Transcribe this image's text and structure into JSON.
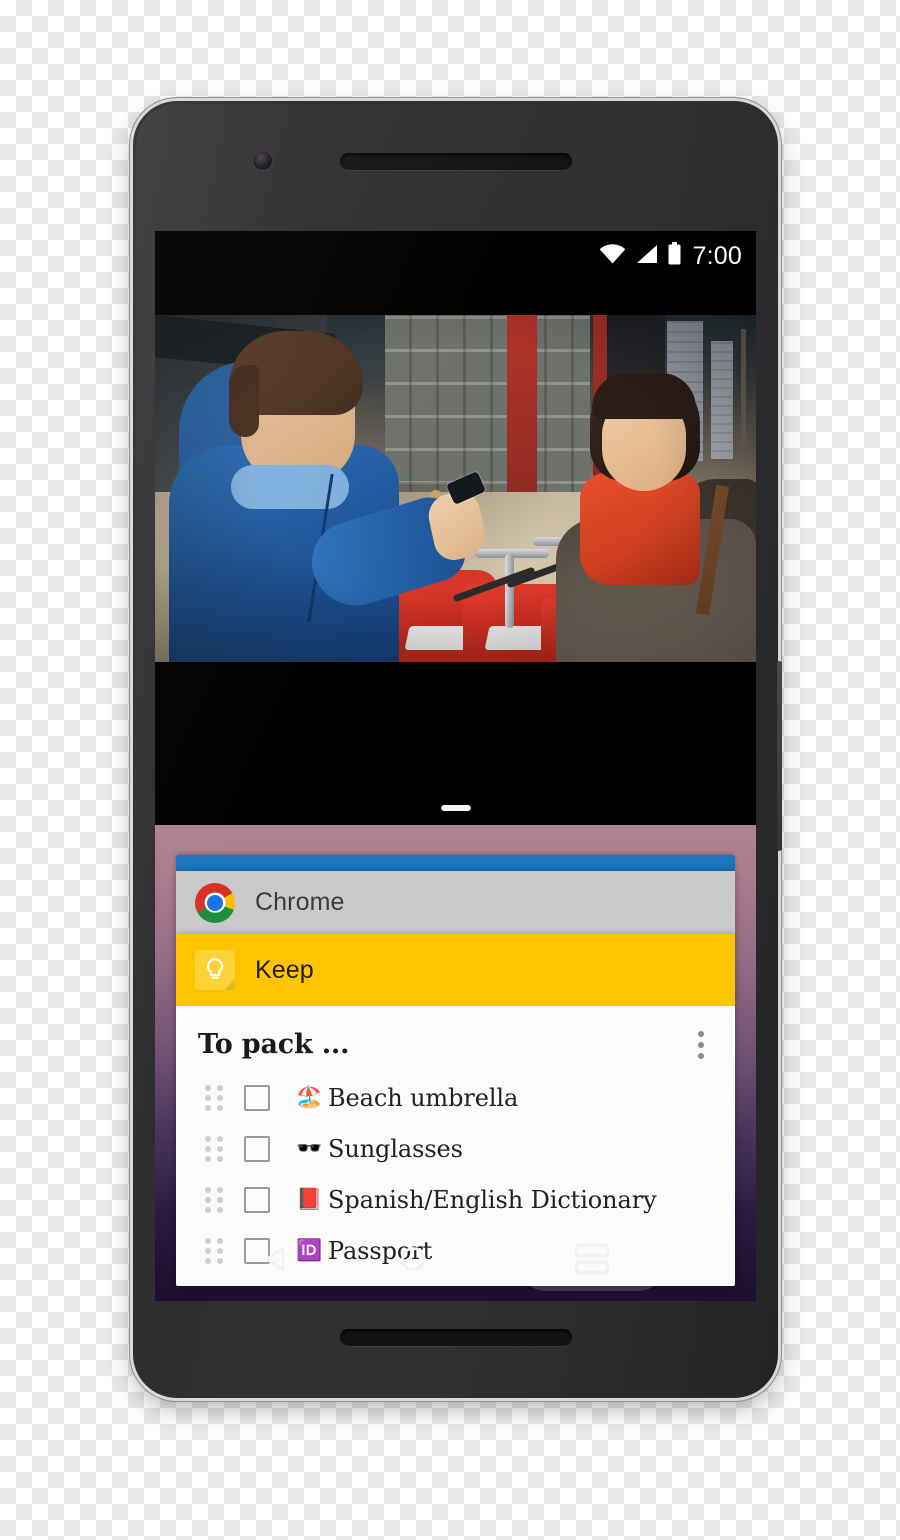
{
  "device": {
    "name": "android-phone-mockup",
    "camera_icon": "front-camera",
    "earpiece_icon": "earpiece-speaker",
    "bottom_speaker_icon": "bottom-speaker",
    "side_button": "power-button"
  },
  "status_bar": {
    "time": "7:00",
    "icons": [
      "wifi-icon",
      "cellular-signal-icon",
      "battery-icon"
    ]
  },
  "top_pane": {
    "name": "video-player-pane",
    "content_description": "Video frame: man in blue hooded jacket holding a phone talking with a woman in a red scarf beside a row of red bike-share bicycles on a city street"
  },
  "divider": {
    "handle_label": "split-screen-divider-handle"
  },
  "recents": {
    "peek_card": {
      "name": "card-peek-previous-app",
      "color": "#1b76bc"
    },
    "cards": [
      {
        "id": "chrome",
        "label": "Chrome",
        "icon": "chrome-icon",
        "header_color": "#c9c9c9"
      },
      {
        "id": "keep",
        "label": "Keep",
        "icon": "keep-icon",
        "header_color": "#ffc400"
      }
    ]
  },
  "note": {
    "title": "To pack ...",
    "overflow_label": "more-options",
    "items": [
      {
        "emoji": "🏖️",
        "emoji_name": "beach-umbrella-emoji",
        "label": "Beach umbrella",
        "checked": false
      },
      {
        "emoji": "🕶️",
        "emoji_name": "sunglasses-emoji",
        "label": "Sunglasses",
        "checked": false
      },
      {
        "emoji": "📕",
        "emoji_name": "closed-book-emoji",
        "label": "Spanish/English Dictionary",
        "checked": false
      },
      {
        "emoji": "🆔",
        "emoji_name": "id-button-emoji",
        "label": "Passport",
        "checked": false
      }
    ]
  },
  "nav_bar": {
    "back_label": "back-button",
    "home_label": "home-button",
    "recents_label": "recents-split-screen-button",
    "recents_highlighted": true
  },
  "colors": {
    "keep_amber": "#ffc400",
    "chrome_gray": "#c9c9c9",
    "peek_blue": "#1b76bc",
    "wallpaper_top": "#b08292",
    "wallpaper_bottom": "#1d0f2e",
    "note_background": "#fbfbfa"
  }
}
